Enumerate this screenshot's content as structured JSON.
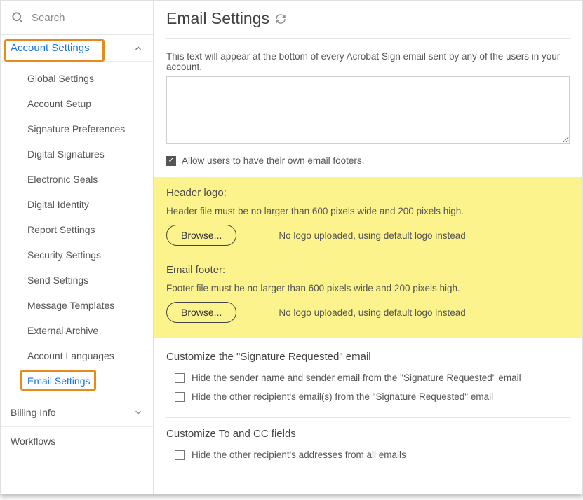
{
  "search": {
    "placeholder": "Search"
  },
  "nav": {
    "account_settings": "Account Settings",
    "items": [
      "Global Settings",
      "Account Setup",
      "Signature Preferences",
      "Digital Signatures",
      "Electronic Seals",
      "Digital Identity",
      "Report Settings",
      "Security Settings",
      "Send Settings",
      "Message Templates",
      "External Archive",
      "Account Languages",
      "Email Settings"
    ],
    "billing": "Billing Info",
    "workflows": "Workflows"
  },
  "page": {
    "title": "Email Settings",
    "footer_intro": "This text will appear at the bottom of every Acrobat Sign email sent by any of the users in your account.",
    "allow_footers": "Allow users to have their own email footers.",
    "header_logo": {
      "title": "Header logo:",
      "desc": "Header file must be no larger than 600 pixels wide and 200 pixels high.",
      "browse": "Browse...",
      "status": "No logo uploaded, using default logo instead"
    },
    "email_footer": {
      "title": "Email footer:",
      "desc": "Footer file must be no larger than 600 pixels wide and 200 pixels high.",
      "browse": "Browse...",
      "status": "No logo uploaded, using default logo instead"
    },
    "sigreq": {
      "title": "Customize the \"Signature Requested\" email",
      "opt1": "Hide the sender name and sender email from the \"Signature Requested\" email",
      "opt2": "Hide the other recipient's email(s) from the \"Signature Requested\" email"
    },
    "tocc": {
      "title": "Customize To and CC fields",
      "opt1": "Hide the other recipient's addresses from all emails"
    }
  }
}
